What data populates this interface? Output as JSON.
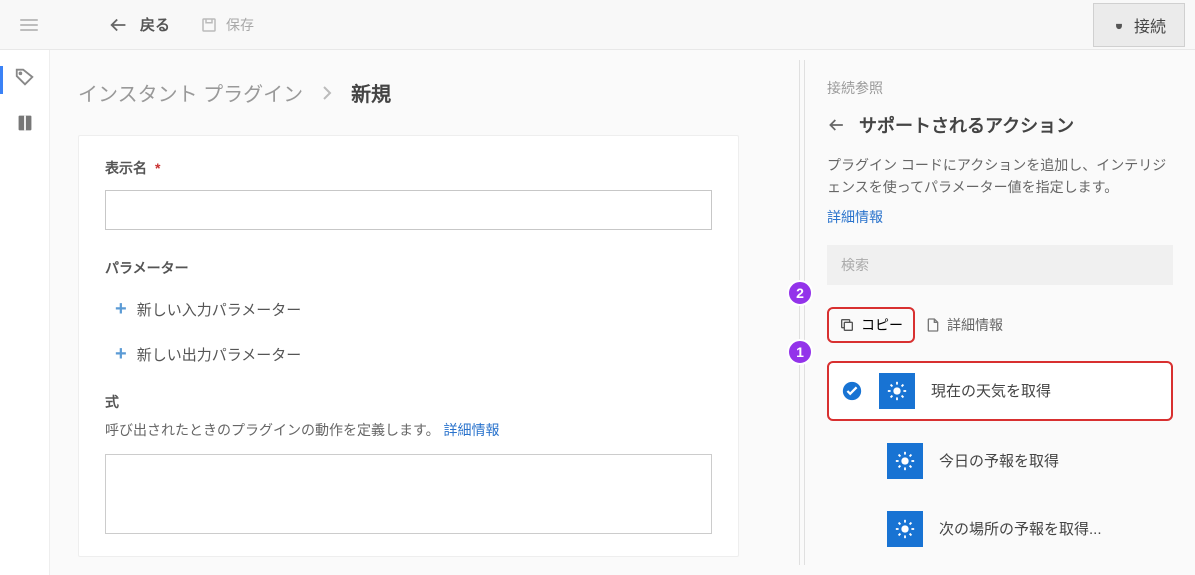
{
  "topbar": {
    "back_label": "戻る",
    "save_label": "保存",
    "connect_label": "接続"
  },
  "breadcrumb": {
    "parent": "インスタント プラグイン",
    "current": "新規"
  },
  "form": {
    "display_name_label": "表示名",
    "display_name_value": "",
    "parameters_header": "パラメーター",
    "add_input_param": "新しい入力パラメーター",
    "add_output_param": "新しい出力パラメーター",
    "formula_header": "式",
    "formula_desc": "呼び出されたときのプラグインの動作を定義します。",
    "formula_link": "詳細情報"
  },
  "right_panel": {
    "crumb": "接続参照",
    "title": "サポートされるアクション",
    "description": "プラグイン コードにアクションを追加し、インテリジェンスを使ってパラメーター値を指定します。",
    "more_link": "詳細情報",
    "search_placeholder": "検索",
    "copy_label": "コピー",
    "info_label": "詳細情報",
    "actions": [
      {
        "label": "現在の天気を取得",
        "selected": true
      },
      {
        "label": "今日の予報を取得",
        "selected": false
      },
      {
        "label": "次の場所の予報を取得...",
        "selected": false
      }
    ]
  },
  "markers": {
    "one": "1",
    "two": "2"
  }
}
